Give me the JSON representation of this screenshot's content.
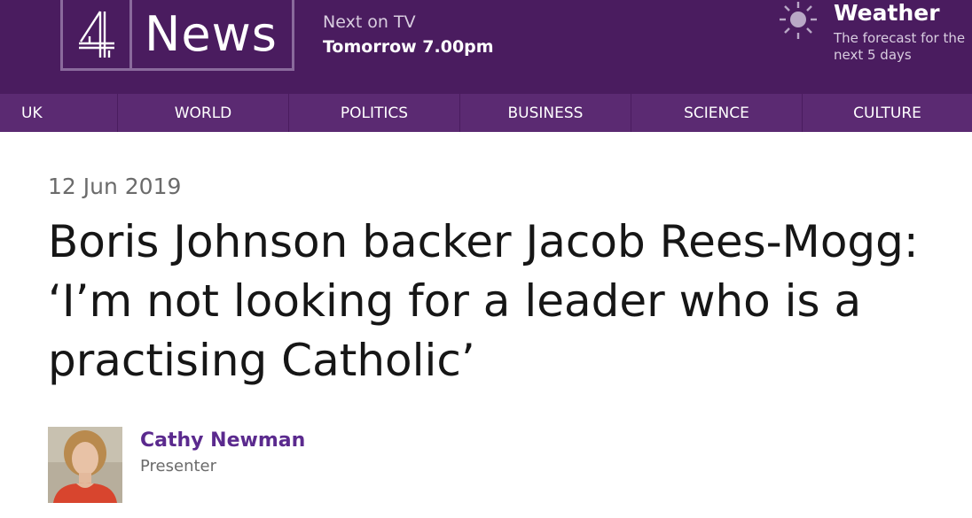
{
  "header": {
    "brand_word": "News",
    "logo_icon": "channel4-logo-icon",
    "next_on_tv_label": "Next on TV",
    "next_on_tv_time": "Tomorrow 7.00pm",
    "weather_title": "Weather",
    "weather_desc": "The forecast for the next 5 days",
    "weather_icon": "sun-icon"
  },
  "nav": {
    "items": [
      {
        "label": "UK"
      },
      {
        "label": "WORLD"
      },
      {
        "label": "POLITICS"
      },
      {
        "label": "BUSINESS"
      },
      {
        "label": "SCIENCE"
      },
      {
        "label": "CULTURE"
      }
    ]
  },
  "article": {
    "date": "12 Jun 2019",
    "headline": "Boris Johnson backer Jacob Rees-Mogg: ‘I’m not looking for a leader who is a practising Catholic’"
  },
  "author": {
    "name": "Cathy Newman",
    "role": "Presenter"
  },
  "colors": {
    "header_bg": "#4a1c5f",
    "nav_bg": "#5b2a72",
    "author_name": "#5b2a8e"
  }
}
